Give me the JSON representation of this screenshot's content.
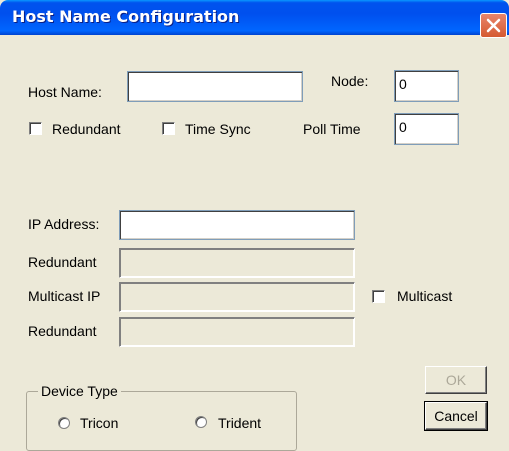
{
  "window": {
    "title": "Host Name Configuration"
  },
  "fields": {
    "host_name_label": "Host Name:",
    "host_name_value": "",
    "node_label": "Node:",
    "node_value": "0",
    "poll_time_label": "Poll Time",
    "poll_time_value": "0",
    "ip_address_label": "IP Address:",
    "ip_address_value": "",
    "redundant_ip_label": "Redundant",
    "multicast_ip_label": "Multicast IP",
    "redundant_multicast_label": "Redundant"
  },
  "checkboxes": {
    "redundant": {
      "label": "Redundant",
      "checked": false
    },
    "time_sync": {
      "label": "Time Sync",
      "checked": false
    },
    "multicast": {
      "label": "Multicast",
      "checked": false
    }
  },
  "device_type": {
    "legend": "Device Type",
    "options": [
      {
        "label": "Tricon",
        "selected": false
      },
      {
        "label": "Trident",
        "selected": false
      }
    ]
  },
  "buttons": {
    "ok": "OK",
    "cancel": "Cancel"
  },
  "colors": {
    "title_bar": "#0054e3",
    "close_button": "#d55a30",
    "dialog_bg": "#ece9d8"
  }
}
